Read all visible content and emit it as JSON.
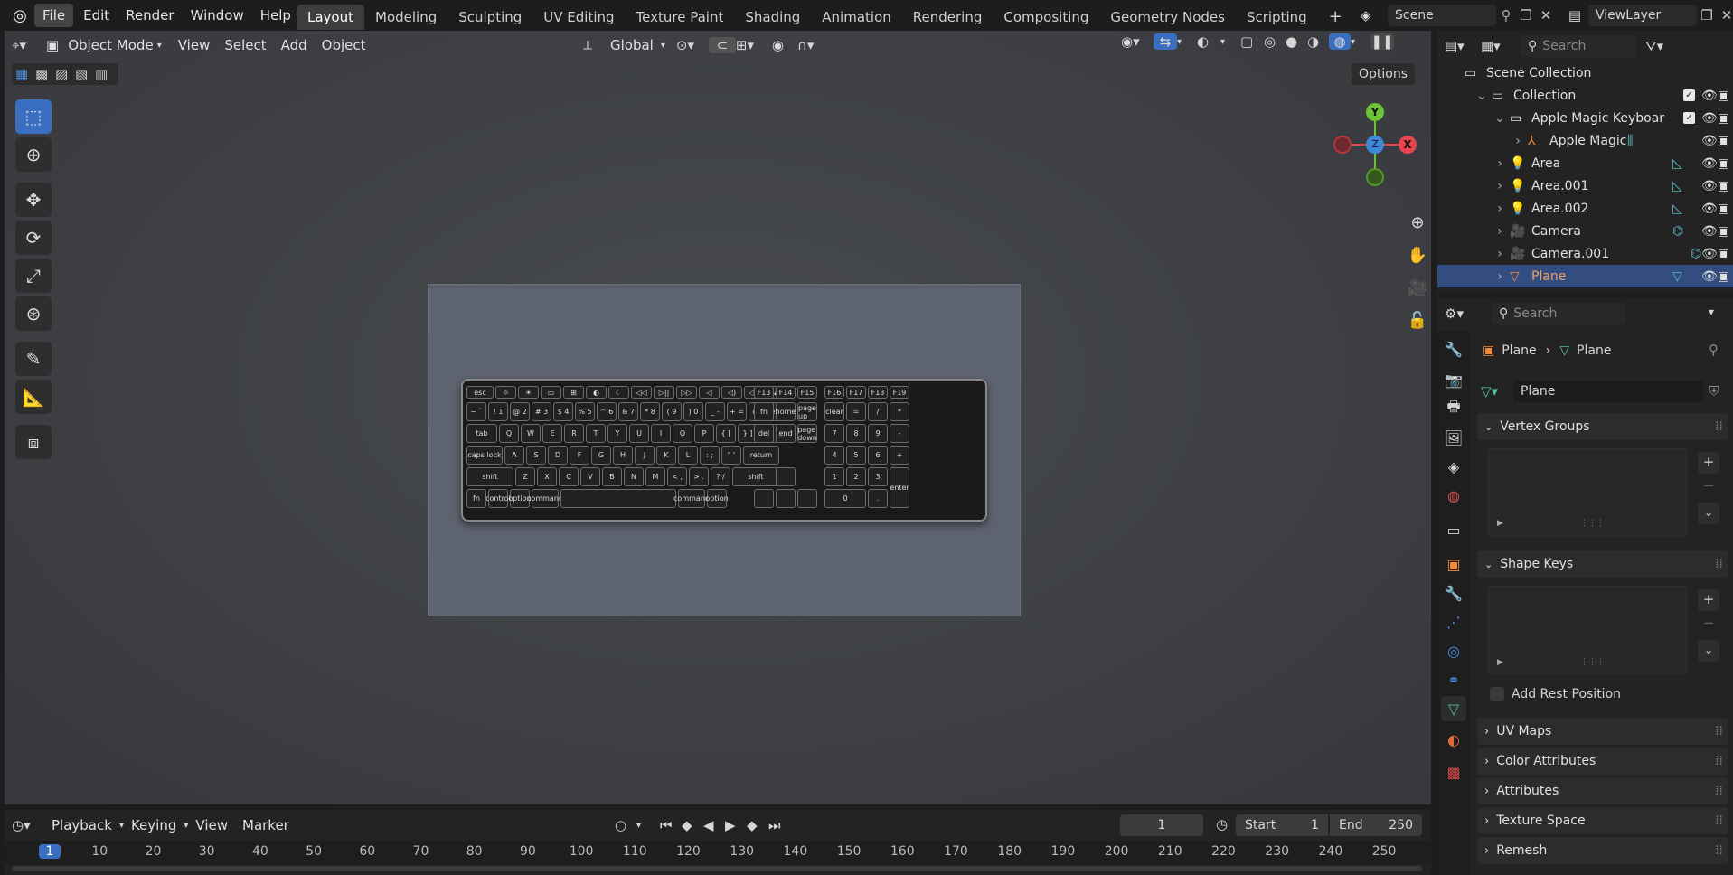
{
  "topbar": {
    "menus": [
      "File",
      "Edit",
      "Render",
      "Window",
      "Help"
    ],
    "workspaces": [
      "Layout",
      "Modeling",
      "Sculpting",
      "UV Editing",
      "Texture Paint",
      "Shading",
      "Animation",
      "Rendering",
      "Compositing",
      "Geometry Nodes",
      "Scripting"
    ],
    "active_workspace": "Layout",
    "scene_name": "Scene",
    "view_layer": "ViewLayer"
  },
  "viewport_header": {
    "mode": "Object Mode",
    "menus": [
      "View",
      "Select",
      "Add",
      "Object"
    ],
    "transform_orientation": "Global",
    "options_label": "Options"
  },
  "gizmo": {
    "y": "Y",
    "z": "Z",
    "x": "X"
  },
  "keyboard": {
    "fn_row": [
      "esc",
      "☼",
      "☀",
      "▭",
      "⊞",
      "◐",
      "☾",
      "◁◁",
      "▷||",
      "▷▷",
      "◁",
      "◁)",
      "◁))",
      "⏏"
    ],
    "num_row": [
      "~ `",
      "! 1",
      "@ 2",
      "# 3",
      "$ 4",
      "% 5",
      "^ 6",
      "& 7",
      "* 8",
      "( 9",
      ") 0",
      "_ -",
      "+ =",
      "delete"
    ],
    "q_row": [
      "tab",
      "Q",
      "W",
      "E",
      "R",
      "T",
      "Y",
      "U",
      "I",
      "O",
      "P",
      "{ [",
      "} ]",
      "| \\"
    ],
    "a_row": [
      "caps lock",
      "A",
      "S",
      "D",
      "F",
      "G",
      "H",
      "J",
      "K",
      "L",
      ": ;",
      "\" '",
      "return"
    ],
    "z_row": [
      "shift",
      "Z",
      "X",
      "C",
      "V",
      "B",
      "N",
      "M",
      "< ,",
      "> .",
      "? /",
      "shift"
    ],
    "bottom_row": [
      "fn",
      "control",
      "option",
      "command",
      "",
      "command",
      "option"
    ],
    "nav_keys": [
      "fn",
      "home",
      "page up",
      "del",
      "end",
      "page down"
    ],
    "num_pad": [
      "clear",
      "=",
      "/",
      "*",
      "7",
      "8",
      "9",
      "-",
      "4",
      "5",
      "6",
      "+",
      "1",
      "2",
      "3",
      "0",
      ".",
      "enter"
    ],
    "f_keys_right": [
      "F13",
      "F14",
      "F15",
      "F16",
      "F17",
      "F18",
      "F19"
    ]
  },
  "outliner": {
    "search_placeholder": "Search",
    "root": "Scene Collection",
    "items": [
      {
        "label": "Collection"
      },
      {
        "label": "Apple Magic Keyboar"
      },
      {
        "label": "Apple Magic"
      },
      {
        "label": "Area"
      },
      {
        "label": "Area.001"
      },
      {
        "label": "Area.002"
      },
      {
        "label": "Camera"
      },
      {
        "label": "Camera.001"
      },
      {
        "label": "Plane"
      }
    ]
  },
  "properties": {
    "search_placeholder": "Search",
    "breadcrumb": [
      "Plane",
      "Plane"
    ],
    "mesh_name": "Plane",
    "panels": {
      "vertex_groups": "Vertex Groups",
      "shape_keys": "Shape Keys",
      "add_rest_position": "Add Rest Position",
      "uv_maps": "UV Maps",
      "color_attributes": "Color Attributes",
      "attributes": "Attributes",
      "texture_space": "Texture Space",
      "remesh": "Remesh"
    }
  },
  "timeline": {
    "menus": [
      "Playback",
      "Keying",
      "View",
      "Marker"
    ],
    "current_frame": "1",
    "start_label": "Start",
    "start": "1",
    "end_label": "End",
    "end": "250",
    "ruler": [
      "1",
      "10",
      "20",
      "30",
      "40",
      "50",
      "60",
      "70",
      "80",
      "90",
      "100",
      "110",
      "120",
      "130",
      "140",
      "150",
      "160",
      "170",
      "180",
      "190",
      "200",
      "210",
      "220",
      "230",
      "240",
      "250"
    ]
  },
  "colors": {
    "accent": "#4772b3",
    "selected_row": "#334d80",
    "plane_text": "#f0a060",
    "gizmo_x": "#e8454f",
    "gizmo_y": "#6bc434",
    "gizmo_z": "#3e88d6"
  }
}
